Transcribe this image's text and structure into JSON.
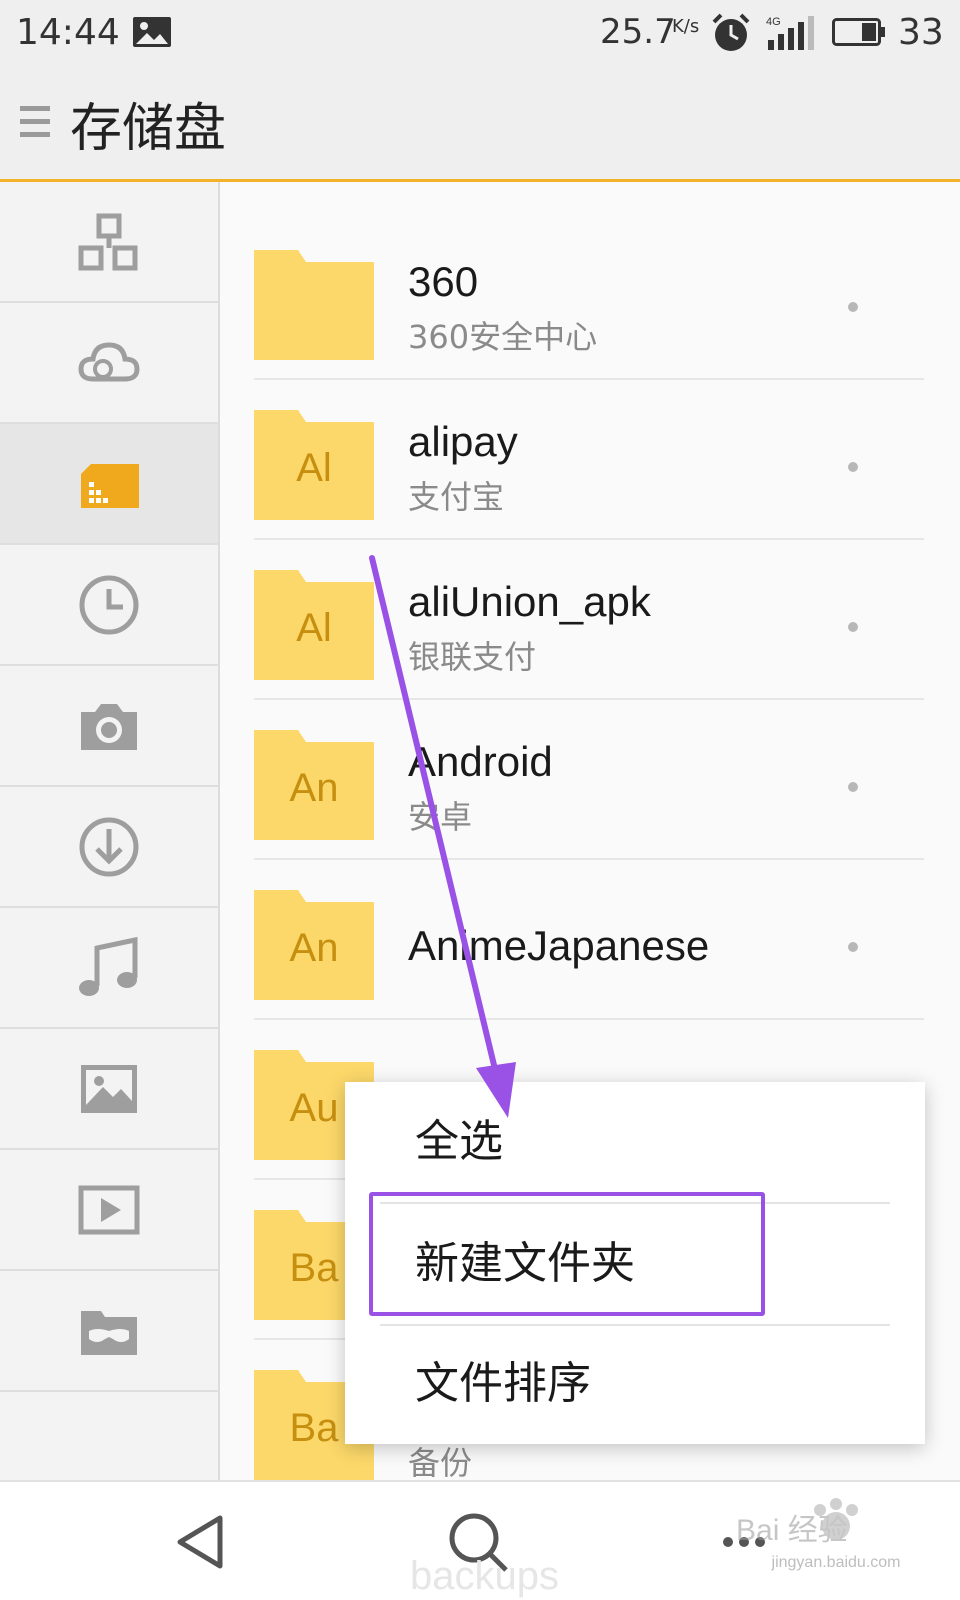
{
  "status_bar": {
    "time": "14:44",
    "network_speed": "25.7",
    "network_speed_unit": "K/s",
    "network_type": "4G",
    "battery_percent": "33"
  },
  "app_bar": {
    "title": "存储盘",
    "menu_icon": "hamburger-menu-icon"
  },
  "sidebar": {
    "items": [
      {
        "icon": "category-icon",
        "active": false
      },
      {
        "icon": "cloud-icon",
        "active": false
      },
      {
        "icon": "storage-card-icon",
        "active": true
      },
      {
        "icon": "recent-clock-icon",
        "active": false
      },
      {
        "icon": "camera-icon",
        "active": false
      },
      {
        "icon": "download-icon",
        "active": false
      },
      {
        "icon": "music-note-icon",
        "active": false
      },
      {
        "icon": "picture-icon",
        "active": false
      },
      {
        "icon": "video-play-icon",
        "active": false
      },
      {
        "icon": "private-folder-icon",
        "active": false
      }
    ]
  },
  "file_list": {
    "rows": [
      {
        "abbr": "",
        "name": "360",
        "description": "360安全中心"
      },
      {
        "abbr": "Al",
        "name": "alipay",
        "description": "支付宝"
      },
      {
        "abbr": "Al",
        "name": "aliUnion_apk",
        "description": "银联支付"
      },
      {
        "abbr": "An",
        "name": "Android",
        "description": "安卓"
      },
      {
        "abbr": "An",
        "name": "AnimeJapanese",
        "description": ""
      },
      {
        "abbr": "Au",
        "name": "",
        "description": ""
      },
      {
        "abbr": "Ba",
        "name": "",
        "description": ""
      },
      {
        "abbr": "Ba",
        "name": "",
        "description": "备份"
      }
    ],
    "partial_row_name": "backups"
  },
  "context_menu": {
    "items": [
      "全选",
      "新建文件夹",
      "文件排序"
    ],
    "highlighted_index": 1
  },
  "annotation": {
    "arrow_color": "#9a52e6",
    "highlight_color": "#9a52e6"
  },
  "navbar": {
    "back_icon": "back-triangle-icon",
    "search_icon": "search-icon",
    "more_icon": "more-options-icon"
  },
  "watermark": {
    "text": "jingyan.baidu.com",
    "logo_text": "Bai 经验"
  },
  "colors": {
    "accent": "#f2b32a",
    "folder": "#fcd86a",
    "folder_text": "#c78f10",
    "active_icon": "#f0a81c",
    "inactive_icon": "#9e9e9e"
  }
}
